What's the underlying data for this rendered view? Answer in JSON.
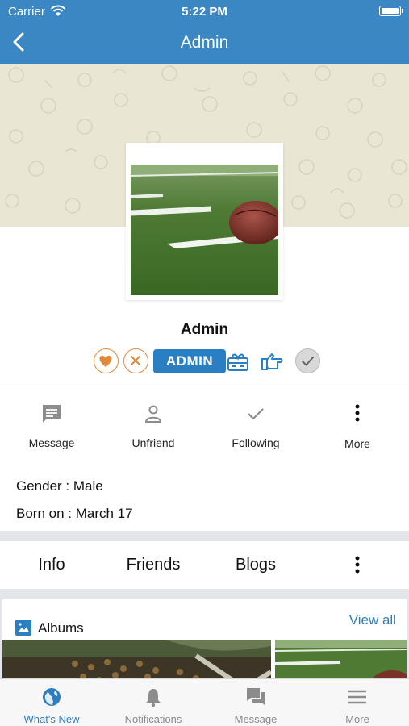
{
  "status_bar": {
    "carrier": "Carrier",
    "time": "5:22 PM"
  },
  "nav": {
    "title": "Admin"
  },
  "profile": {
    "name": "Admin",
    "role_badge": "ADMIN"
  },
  "actions": [
    {
      "label": "Message",
      "icon": "message-icon"
    },
    {
      "label": "Unfriend",
      "icon": "person-icon"
    },
    {
      "label": "Following",
      "icon": "check-icon"
    },
    {
      "label": "More",
      "icon": "more-vertical-icon"
    }
  ],
  "about": {
    "gender": "Gender : Male",
    "born": "Born on : March 17"
  },
  "tabs": [
    {
      "label": "Info"
    },
    {
      "label": "Friends"
    },
    {
      "label": "Blogs"
    }
  ],
  "albums": {
    "title": "Albums",
    "view_all": "View all"
  },
  "tabbar": [
    {
      "label": "What's New",
      "icon": "globe-icon",
      "active": true
    },
    {
      "label": "Notifications",
      "icon": "bell-icon",
      "active": false
    },
    {
      "label": "Message",
      "icon": "chat-icon",
      "active": false
    },
    {
      "label": "More",
      "icon": "menu-icon",
      "active": false
    }
  ],
  "colors": {
    "brand_blue": "#3b87c3",
    "accent_blue": "#2a7fc2",
    "orange": "#e08a3a",
    "cover_bg": "#e9e6d3"
  }
}
